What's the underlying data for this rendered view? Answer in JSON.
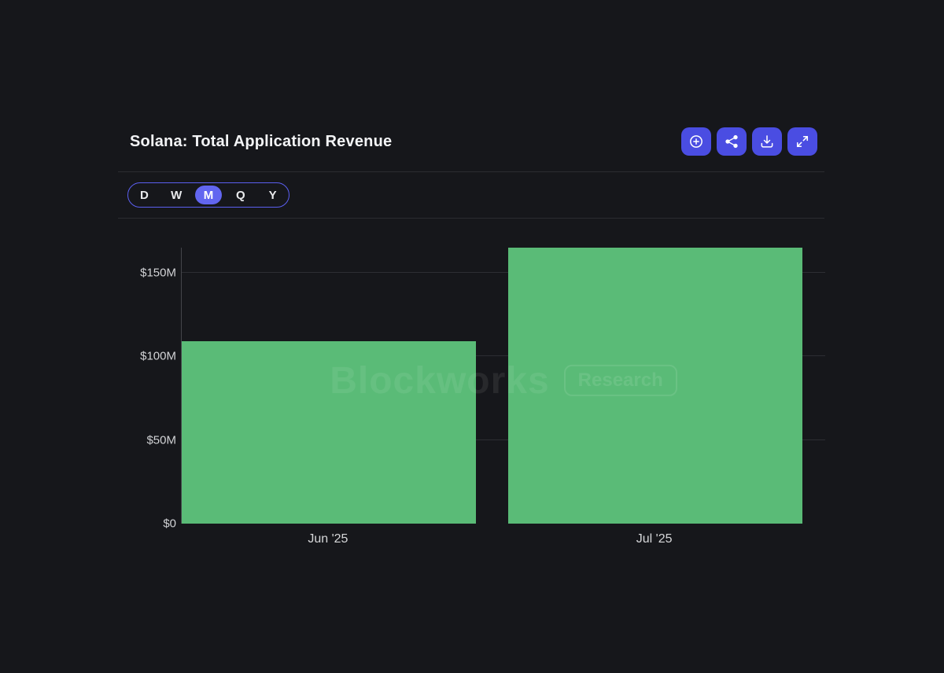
{
  "header": {
    "title": "Solana: Total Application Revenue",
    "actions": [
      {
        "id": "zoom-in",
        "icon": "plus-circle-icon"
      },
      {
        "id": "share",
        "icon": "share-icon"
      },
      {
        "id": "download",
        "icon": "download-icon"
      },
      {
        "id": "fullscreen",
        "icon": "expand-icon"
      }
    ]
  },
  "range_selector": {
    "options": [
      "D",
      "W",
      "M",
      "Q",
      "Y"
    ],
    "selected": "M"
  },
  "watermark": {
    "brand": "Blockworks",
    "badge": "Research"
  },
  "chart_data": {
    "type": "bar",
    "title": "Solana: Total Application Revenue",
    "categories": [
      "Jun '25",
      "Jul '25"
    ],
    "series": [
      {
        "name": "Total Application Revenue",
        "values": [
          109,
          165
        ]
      }
    ],
    "unit": "USD millions",
    "yticks": [
      {
        "value": 0,
        "label": "$0"
      },
      {
        "value": 50,
        "label": "$50M"
      },
      {
        "value": 100,
        "label": "$100M"
      },
      {
        "value": 150,
        "label": "$150M"
      }
    ],
    "ylim": [
      0,
      165
    ],
    "xlabel": "",
    "ylabel": "",
    "grid": true,
    "legend": false,
    "bar_color": "#5abb77"
  },
  "colors": {
    "background": "#16171b",
    "accent": "#4a4de2",
    "selected_range": "#6266f0",
    "bar": "#5abb77"
  }
}
